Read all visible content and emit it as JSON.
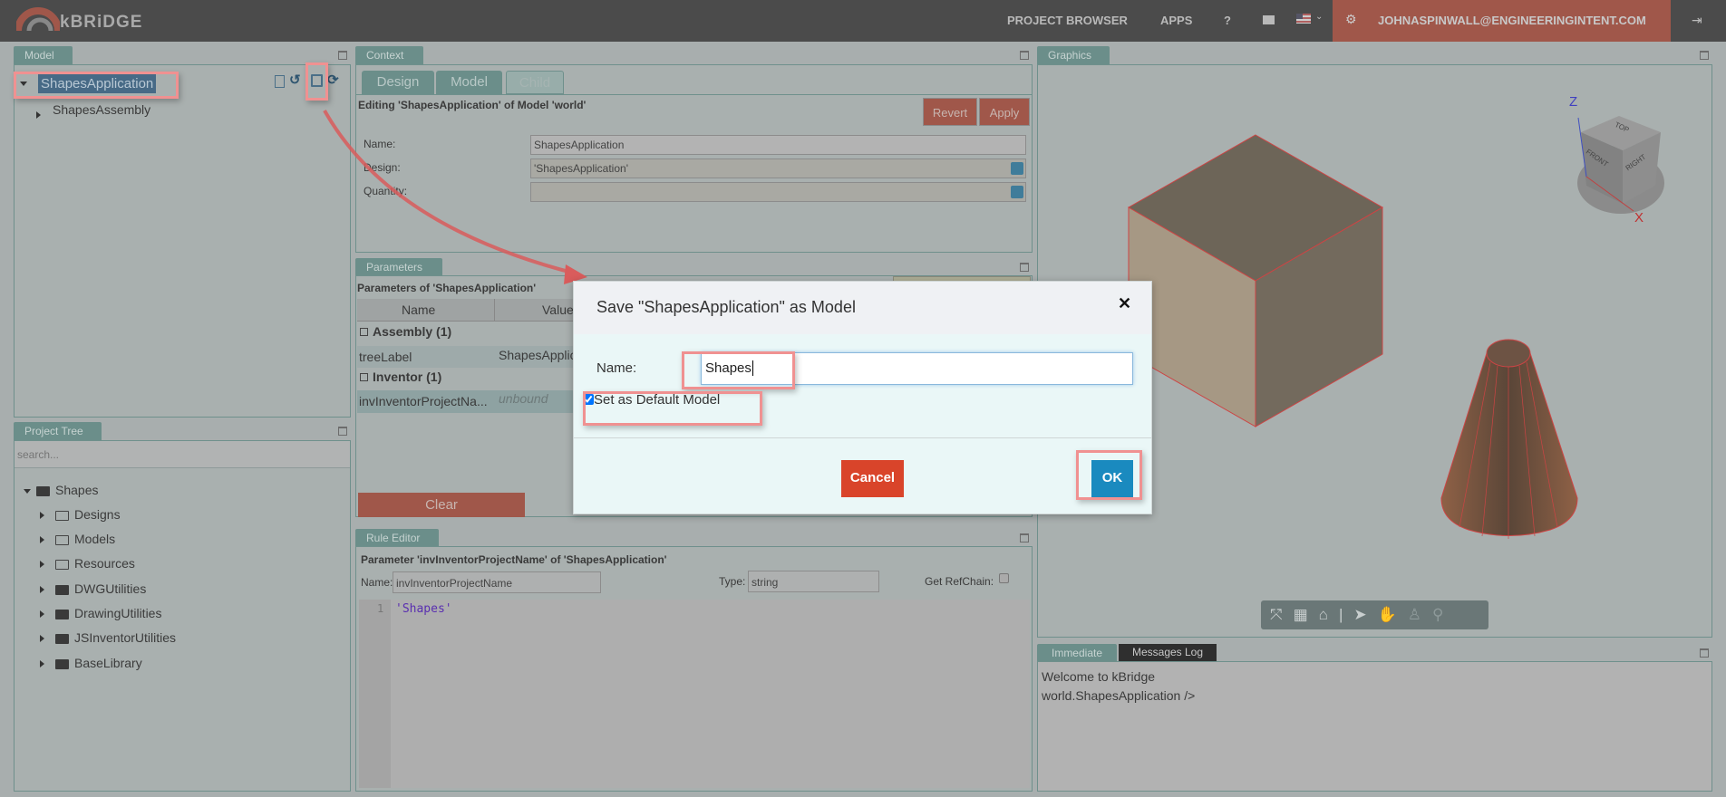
{
  "header": {
    "logo": "kBRiDGE",
    "nav": [
      "PROJECT BROWSER",
      "APPS",
      "?"
    ],
    "mail_icon": "envelope-icon",
    "flag_icon": "us-flag-icon",
    "user_email": "JOHNASPINWALL@ENGINEERINGINTENT.COM",
    "gear_icon": "gear-icon",
    "logout_icon": "sign-out-icon"
  },
  "model_panel": {
    "title": "Model",
    "root": "ShapesApplication",
    "child": "ShapesAssembly",
    "toolbar_icons": [
      "code-file-icon",
      "history-icon",
      "save-icon",
      "refresh-icon"
    ]
  },
  "project_tree": {
    "title": "Project Tree",
    "search_placeholder": "search...",
    "root": "Shapes",
    "items": [
      {
        "label": "Designs",
        "icon": "folder-open-outline"
      },
      {
        "label": "Models",
        "icon": "folder-outline"
      },
      {
        "label": "Resources",
        "icon": "folder-outline"
      },
      {
        "label": "DWGUtilities",
        "icon": "folder"
      },
      {
        "label": "DrawingUtilities",
        "icon": "folder"
      },
      {
        "label": "JSInventorUtilities",
        "icon": "folder"
      },
      {
        "label": "BaseLibrary",
        "icon": "folder"
      }
    ]
  },
  "context": {
    "title": "Context",
    "tabs": [
      "Design",
      "Model",
      "Child"
    ],
    "editing": "Editing 'ShapesApplication' of Model 'world'",
    "revert": "Revert",
    "apply": "Apply",
    "fields": [
      {
        "label": "Name:",
        "value": "ShapesApplication"
      },
      {
        "label": "Design:",
        "value": "'ShapesApplication'"
      },
      {
        "label": "Quantity:",
        "value": ""
      }
    ]
  },
  "parameters": {
    "title": "Parameters",
    "heading": "Parameters of 'ShapesApplication'",
    "columns": [
      "Name",
      "Value"
    ],
    "groups": [
      {
        "label": "Assembly (1)",
        "rows": [
          {
            "name": "treeLabel",
            "value": "ShapesApplic"
          }
        ]
      },
      {
        "label": "Inventor (1)",
        "rows": [
          {
            "name": "invInventorProjectNa...",
            "value": "unbound"
          }
        ]
      }
    ],
    "clear": "Clear"
  },
  "rule_editor": {
    "title": "Rule Editor",
    "heading": "Parameter 'invInventorProjectName' of 'ShapesApplication'",
    "name_label": "Name:",
    "name_value": "invInventorProjectName",
    "type_label": "Type:",
    "type_value": "string",
    "refchain_label": "Get RefChain:",
    "line_no": "1",
    "code": "'Shapes'"
  },
  "graphics": {
    "title": "Graphics",
    "viewcube": {
      "top": "TOP",
      "front": "FRONT",
      "right": "RIGHT",
      "z": "Z",
      "x": "X"
    },
    "toolbar_icons": [
      "fit-icon",
      "layout-icon",
      "home-icon",
      "select-icon",
      "pan-icon",
      "walk-icon",
      "zoom-icon"
    ]
  },
  "console": {
    "tabs": [
      "Immediate",
      "Messages Log"
    ],
    "lines": [
      "Welcome to kBridge",
      "world.ShapesApplication />"
    ]
  },
  "dialog": {
    "title": "Save \"ShapesApplication\" as Model",
    "name_label": "Name:",
    "name_value": "Shapes",
    "checkbox_label": "Set as Default Model",
    "checkbox_checked": true,
    "cancel": "Cancel",
    "ok": "OK"
  },
  "colors": {
    "header": "#4b4b4b",
    "accent": "#a0574a",
    "tab": "#6b8e8a",
    "cancel": "#d9442a",
    "ok": "#1a8abf",
    "annotation": "#f09191"
  }
}
